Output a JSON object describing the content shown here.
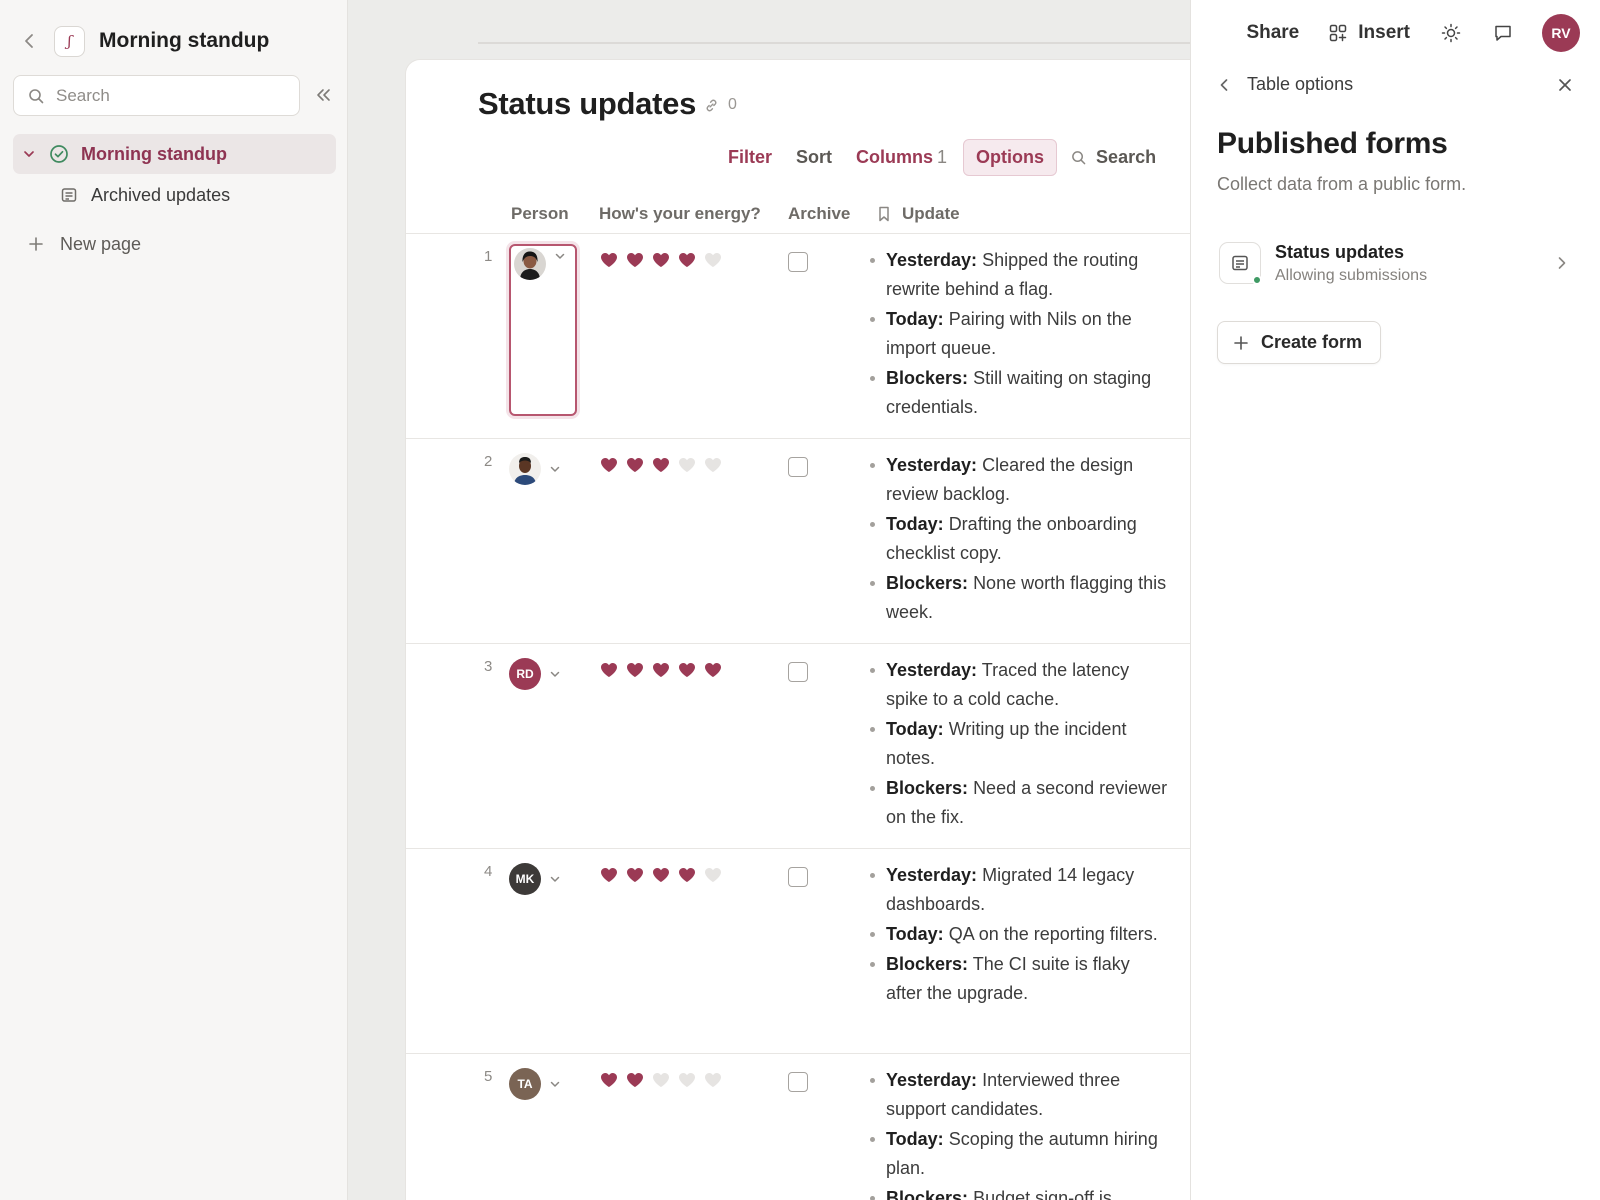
{
  "sidebar": {
    "title": "Morning standup",
    "search_placeholder": "Search",
    "items": [
      {
        "label": "Morning standup"
      },
      {
        "label": "Archived updates"
      }
    ],
    "new_page_label": "New page"
  },
  "main": {
    "title": "Status updates",
    "link_count": "0",
    "toolbar": {
      "filter": "Filter",
      "sort": "Sort",
      "columns": "Columns",
      "columns_count": "1",
      "options": "Options",
      "search": "Search"
    },
    "columns": {
      "person": "Person",
      "energy": "How's your energy?",
      "archive": "Archive",
      "update": "Update"
    },
    "rows": [
      {
        "num": "1",
        "avatar": {
          "type": "photo",
          "initials": ""
        },
        "energy": 4,
        "archived": false,
        "yesterday_label": "Yesterday:",
        "yesterday": "Shipped the routing rewrite behind a flag.",
        "today_label": "Today:",
        "today": "Pairing with Nils on the import queue.",
        "blockers_label": "Blockers:",
        "blockers": "Still waiting on staging credentials."
      },
      {
        "num": "2",
        "avatar": {
          "type": "photo",
          "initials": ""
        },
        "energy": 3,
        "archived": false,
        "yesterday_label": "Yesterday:",
        "yesterday": "Cleared the design review backlog.",
        "today_label": "Today:",
        "today": "Drafting the onboarding checklist copy.",
        "blockers_label": "Blockers:",
        "blockers": "None worth flagging this week."
      },
      {
        "num": "3",
        "avatar": {
          "type": "initials",
          "initials": "RD",
          "color": "#9b3a55"
        },
        "energy": 5,
        "archived": false,
        "yesterday_label": "Yesterday:",
        "yesterday": "Traced the latency spike to a cold cache.",
        "today_label": "Today:",
        "today": "Writing up the incident notes.",
        "blockers_label": "Blockers:",
        "blockers": "Need a second reviewer on the fix."
      },
      {
        "num": "4",
        "avatar": {
          "type": "initials",
          "initials": "MK",
          "color": "#3d3a38"
        },
        "energy": 4,
        "archived": false,
        "yesterday_label": "Yesterday:",
        "yesterday": "Migrated 14 legacy dashboards.",
        "today_label": "Today:",
        "today": "QA on the reporting filters.",
        "blockers_label": "Blockers:",
        "blockers": "The CI suite is flaky after the upgrade."
      },
      {
        "num": "5",
        "avatar": {
          "type": "initials",
          "initials": "TA",
          "color": "#7a6454"
        },
        "energy": 2,
        "archived": false,
        "yesterday_label": "Yesterday:",
        "yesterday": "Interviewed three support candidates.",
        "today_label": "Today:",
        "today": "Scoping the autumn hiring plan.",
        "blockers_label": "Blockers:",
        "blockers": "Budget sign-off is"
      }
    ],
    "heart_color_on": "#9b3a55",
    "heart_color_off": "#e6e4e2"
  },
  "right_panel": {
    "share": "Share",
    "insert": "Insert",
    "user_initials": "RV",
    "nav_label": "Table options",
    "title": "Published forms",
    "subtitle": "Collect data from a public form.",
    "form": {
      "name": "Status updates",
      "status": "Allowing submissions"
    },
    "create_form": "Create form"
  },
  "colors": {
    "accent": "#9b3a55",
    "status_green": "#3f9a64"
  }
}
